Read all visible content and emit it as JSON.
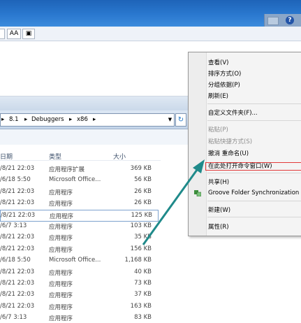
{
  "toolbar": {
    "font_btn": "AA",
    "preview_btn": "▣"
  },
  "address": {
    "crumbs": [
      "8.1",
      "Debuggers",
      "x86"
    ],
    "sep": "▸"
  },
  "columns": {
    "date": "日期",
    "type": "类型",
    "size": "大小"
  },
  "rows": [
    {
      "date": "/8/21 22:03",
      "type": "应用程序扩展",
      "size": "369 KB"
    },
    {
      "date": "/6/18 5:50",
      "type": "Microsoft Office...",
      "size": "56 KB"
    },
    {
      "date": "/8/21 22:03",
      "type": "应用程序",
      "size": "26 KB"
    },
    {
      "date": "/8/21 22:03",
      "type": "应用程序",
      "size": "26 KB"
    },
    {
      "date": "/8/21 22:03",
      "type": "应用程序",
      "size": "125 KB"
    },
    {
      "date": "/6/7 3:13",
      "type": "应用程序",
      "size": "103 KB"
    },
    {
      "date": "/8/21 22:03",
      "type": "应用程序",
      "size": "35 KB"
    },
    {
      "date": "/8/21 22:03",
      "type": "应用程序",
      "size": "156 KB"
    },
    {
      "date": "/6/18 5:50",
      "type": "Microsoft Office...",
      "size": "1,168 KB"
    },
    {
      "date": "/8/21 22:03",
      "type": "应用程序",
      "size": "40 KB"
    },
    {
      "date": "/8/21 22:03",
      "type": "应用程序",
      "size": "73 KB"
    },
    {
      "date": "/8/21 22:03",
      "type": "应用程序",
      "size": "37 KB"
    },
    {
      "date": "/8/21 22:03",
      "type": "应用程序",
      "size": "163 KB"
    },
    {
      "date": "/6/7 3:13",
      "type": "应用程序",
      "size": "83 KB"
    }
  ],
  "menu": {
    "view": "查看(V)",
    "sort": "排序方式(O)",
    "group": "分组依据(P)",
    "refresh": "刷新(E)",
    "customize": "自定义文件夹(F)...",
    "paste": "粘贴(P)",
    "paste_shortcut": "粘贴快捷方式(S)",
    "undo_rename": "撤消 重命名(U)",
    "open_cmd": "在此处打开命令窗口(W)",
    "share": "共享(H)",
    "groove": "Groove Folder Synchronization",
    "new": "新建(W)",
    "properties": "属性(R)"
  },
  "colors": {
    "highlight_box": "#e23a3a",
    "arrow": "#1f8a8a"
  }
}
